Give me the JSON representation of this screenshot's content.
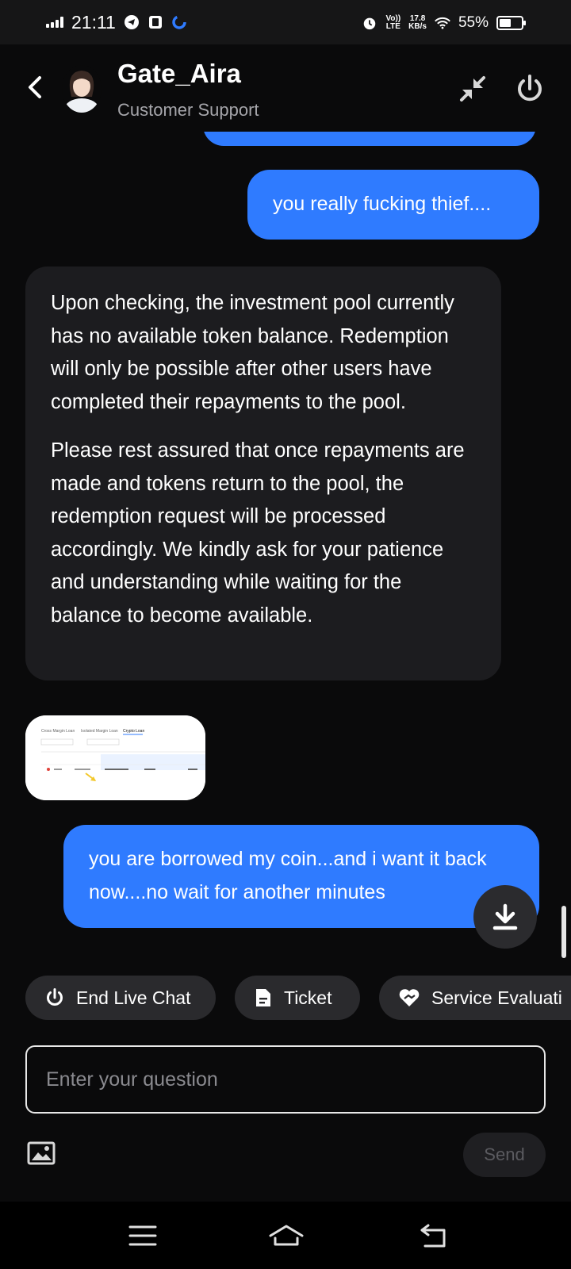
{
  "status_bar": {
    "time": "21:11",
    "volte_line1": "Vo))",
    "volte_line2": "LTE",
    "net_speed_value": "17.8",
    "net_speed_unit": "KB/s",
    "battery_percent": "55%",
    "battery_level": 0.55,
    "icons": [
      "signal-icon",
      "telegram-icon",
      "app-icon",
      "sync-icon",
      "alarm-icon",
      "wifi-icon",
      "battery-icon"
    ]
  },
  "header": {
    "name": "Gate_Aira",
    "role": "Customer Support",
    "icons": [
      "back-arrow-icon",
      "avatar",
      "minimize-icon",
      "power-icon"
    ]
  },
  "messages": [
    {
      "from": "user",
      "text": "you really fucking thief...."
    },
    {
      "from": "agent",
      "paragraphs": [
        "Upon checking, the investment pool currently has no available token balance. Redemption will only be possible after other users have completed their repayments to the pool.",
        "Please rest assured that once repayments are made and tokens return to the pool, the redemption request will be processed accordingly. We kindly ask for your patience and understanding while waiting for the balance to become available."
      ]
    },
    {
      "from": "agent",
      "type": "image",
      "image_tabs": [
        "Cross Margin Loan",
        "Isolated Margin Loan",
        "Crypto Loan"
      ]
    },
    {
      "from": "user",
      "text": "you are borrowed my coin...and i want it back now....no wait for another minutes"
    }
  ],
  "quick_actions": [
    {
      "label": "End Live Chat",
      "icon": "power-icon"
    },
    {
      "label": "Ticket",
      "icon": "document-icon"
    },
    {
      "label": "Service Evaluati",
      "icon": "heart-hand-icon"
    }
  ],
  "composer": {
    "placeholder": "Enter your question",
    "value": "",
    "send_label": "Send",
    "image_icon": "image-icon"
  },
  "colors": {
    "background": "#0a0a0b",
    "user_bubble": "#2f7bff",
    "agent_bubble": "#1c1c1f",
    "chip": "#2a2a2d"
  }
}
